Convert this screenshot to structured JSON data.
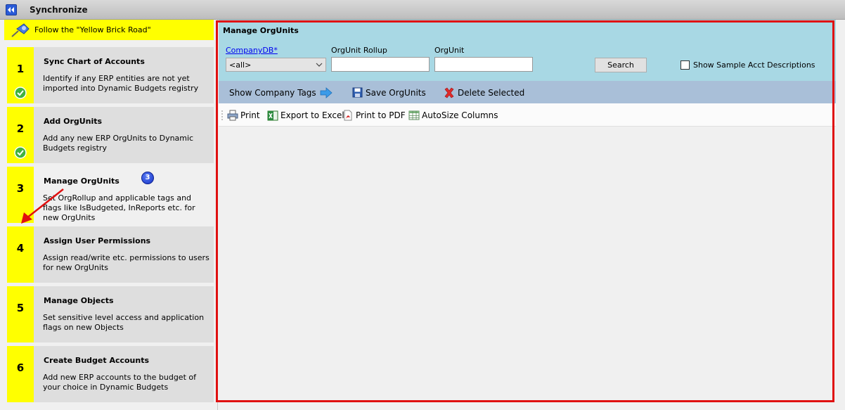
{
  "window": {
    "title": "Synchronize"
  },
  "wizard": {
    "banner": "Follow the \"Yellow Brick Road\"",
    "steps": [
      {
        "number": "1",
        "title": "Sync Chart of Accounts",
        "description": "Identify if any ERP entities are not yet imported into Dynamic Budgets registry",
        "completed": true
      },
      {
        "number": "2",
        "title": "Add OrgUnits",
        "description": "Add any new ERP OrgUnits to Dynamic Budgets registry",
        "completed": true
      },
      {
        "number": "3",
        "title": "Manage OrgUnits",
        "description": "Set OrgRollup and applicable tags and flags like IsBudgeted, InReports etc. for new OrgUnits",
        "completed": false,
        "badge": "3"
      },
      {
        "number": "4",
        "title": "Assign User Permissions",
        "description": "Assign read/write etc. permissions to users for new OrgUnits",
        "completed": false
      },
      {
        "number": "5",
        "title": "Manage Objects",
        "description": "Set sensitive level access and application flags on new Objects",
        "completed": false
      },
      {
        "number": "6",
        "title": "Create Budget Accounts",
        "description": "Add new ERP accounts to the budget of your choice in Dynamic Budgets",
        "completed": false
      }
    ]
  },
  "panel": {
    "title": "Manage OrgUnits",
    "filters": {
      "company_label": "CompanyDB*",
      "company_value": "<all>",
      "rollup_label": "OrgUnit Rollup",
      "rollup_value": "",
      "orgunit_label": "OrgUnit",
      "orgunit_value": "",
      "search_label": "Search",
      "sample_label": "Show Sample Acct Descriptions",
      "sample_checked": false
    },
    "actions": {
      "show_tags": "Show Company Tags",
      "save": "Save OrgUnits",
      "delete": "Delete Selected"
    },
    "toolbar": {
      "print": "Print",
      "export": "Export to Excel",
      "pdf": "Print to PDF",
      "autosize": "AutoSize Columns"
    }
  },
  "colors": {
    "highlight_yellow": "#ffff00",
    "annotation_red": "#e01010",
    "filter_bg": "#a8d8e4",
    "action_bg": "#a9bfd8"
  }
}
